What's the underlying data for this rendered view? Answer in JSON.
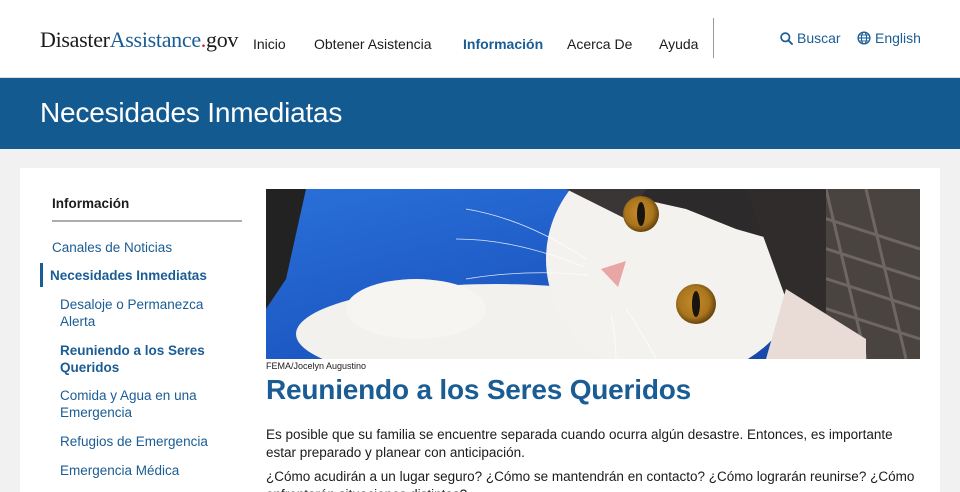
{
  "header": {
    "logo": {
      "part1": "Disaster",
      "part2": "Assistance",
      "dot": ".",
      "part3": "gov"
    },
    "nav": [
      {
        "label": "Inicio",
        "active": false
      },
      {
        "label": "Obtener Asistencia",
        "active": false
      },
      {
        "label": "Información",
        "active": true
      },
      {
        "label": "Acerca De",
        "active": false
      },
      {
        "label": "Ayuda",
        "active": false
      }
    ],
    "search_label": "Buscar",
    "search_icon": "search-icon",
    "language_label": "English",
    "language_icon": "globe-icon"
  },
  "banner": {
    "title": "Necesidades Inmediatas"
  },
  "sidebar": {
    "heading": "Información",
    "items": [
      {
        "label": "Canales de Noticias",
        "level": 1
      },
      {
        "label": "Necesidades Inmediatas",
        "level": 1,
        "current": true
      },
      {
        "label": "Desaloje o Permanezca Alerta",
        "level": 2
      },
      {
        "label": "Reuniendo a los Seres Queridos",
        "level": 2,
        "current": true
      },
      {
        "label": "Comida y Agua en una Emergencia",
        "level": 2
      },
      {
        "label": "Refugios de Emergencia",
        "level": 2
      },
      {
        "label": "Emergencia Médica",
        "level": 2
      }
    ]
  },
  "main": {
    "image_credit": "FEMA/Jocelyn Augustino",
    "title": "Reuniendo a los Seres Queridos",
    "paragraphs": [
      "Es posible que su familia se encuentre separada cuando ocurra algún desastre. Entonces, es importante estar preparado y planear con anticipación.",
      "¿Cómo acudirán a un lugar seguro? ¿Cómo se mantendrán en contacto? ¿Cómo lograrán reunirse? ¿Cómo enfrentarán situaciones distintas?"
    ]
  },
  "colors": {
    "brand_blue": "#125a8f",
    "link_blue": "#1a5c94",
    "logo_dot_red": "#d32027"
  }
}
